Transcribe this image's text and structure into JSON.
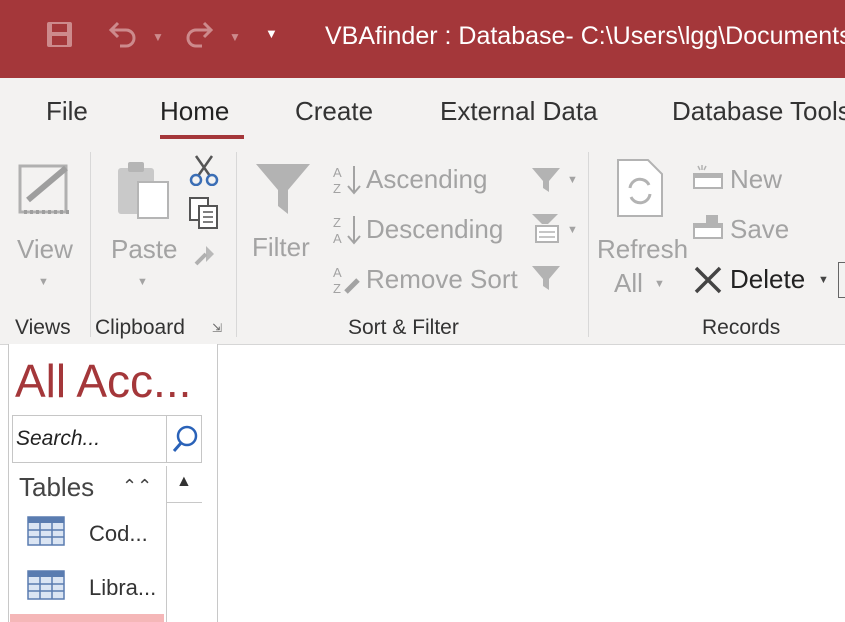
{
  "title_bar": {
    "title": "VBAfinder : Database- C:\\Users\\lgg\\Documents"
  },
  "quick_access": {
    "save_icon": "save-icon",
    "undo_icon": "undo-icon",
    "redo_icon": "redo-icon",
    "customize_icon": "customize-icon"
  },
  "tabs": [
    {
      "label": "File"
    },
    {
      "label": "Home"
    },
    {
      "label": "Create"
    },
    {
      "label": "External Data"
    },
    {
      "label": "Database Tools"
    }
  ],
  "ribbon": {
    "views": {
      "view_label": "View",
      "group_label": "Views"
    },
    "clipboard": {
      "paste_label": "Paste",
      "group_label": "Clipboard"
    },
    "sort_filter": {
      "filter_label": "Filter",
      "ascending_label": "Ascending",
      "descending_label": "Descending",
      "remove_sort_label": "Remove Sort",
      "group_label": "Sort & Filter"
    },
    "records": {
      "refresh_label": "Refresh",
      "refresh_sub_label": "All",
      "new_label": "New",
      "save_label": "Save",
      "delete_label": "Delete",
      "group_label": "Records"
    }
  },
  "navigation_pane": {
    "title": "All Acc...",
    "search_placeholder": "Search...",
    "section": "Tables",
    "items": [
      {
        "label": "Cod..."
      },
      {
        "label": "Libra..."
      }
    ]
  },
  "colors": {
    "accent": "#a4373a",
    "ribbon_bg": "#f3f2f1",
    "disabled": "#a3a3a3",
    "selection": "#f5b7b8"
  }
}
